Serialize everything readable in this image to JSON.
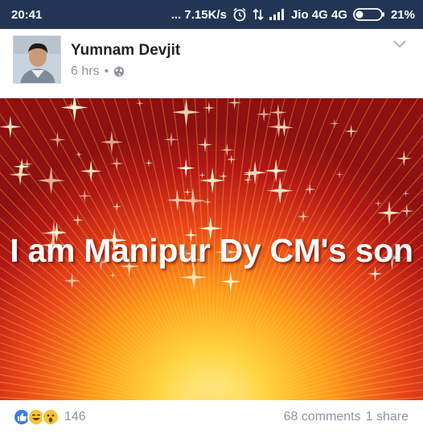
{
  "status_bar": {
    "time": "20:41",
    "network_speed": "... 7.15K/s",
    "carrier": "Jio 4G 4G",
    "battery": "21%"
  },
  "post": {
    "author": "Yumnam Devjit",
    "time": "6 hrs",
    "separator": "•",
    "image_caption": "I am Manipur Dy CM's son",
    "reaction_count": "146",
    "comments": "68 comments",
    "shares": "1 share"
  },
  "colors": {
    "status_bar_bg": "#223555",
    "author_text": "#1d2129",
    "meta_text": "#90949c",
    "like_blue": "#3b7cf0",
    "haha_yellow": "#f7c433"
  },
  "icons": [
    "alarm-icon",
    "data-arrows-icon",
    "signal-icon",
    "battery-icon",
    "globe-icon",
    "chevron-down-icon",
    "like-reaction-icon",
    "haha-reaction-icon",
    "wow-reaction-icon"
  ]
}
